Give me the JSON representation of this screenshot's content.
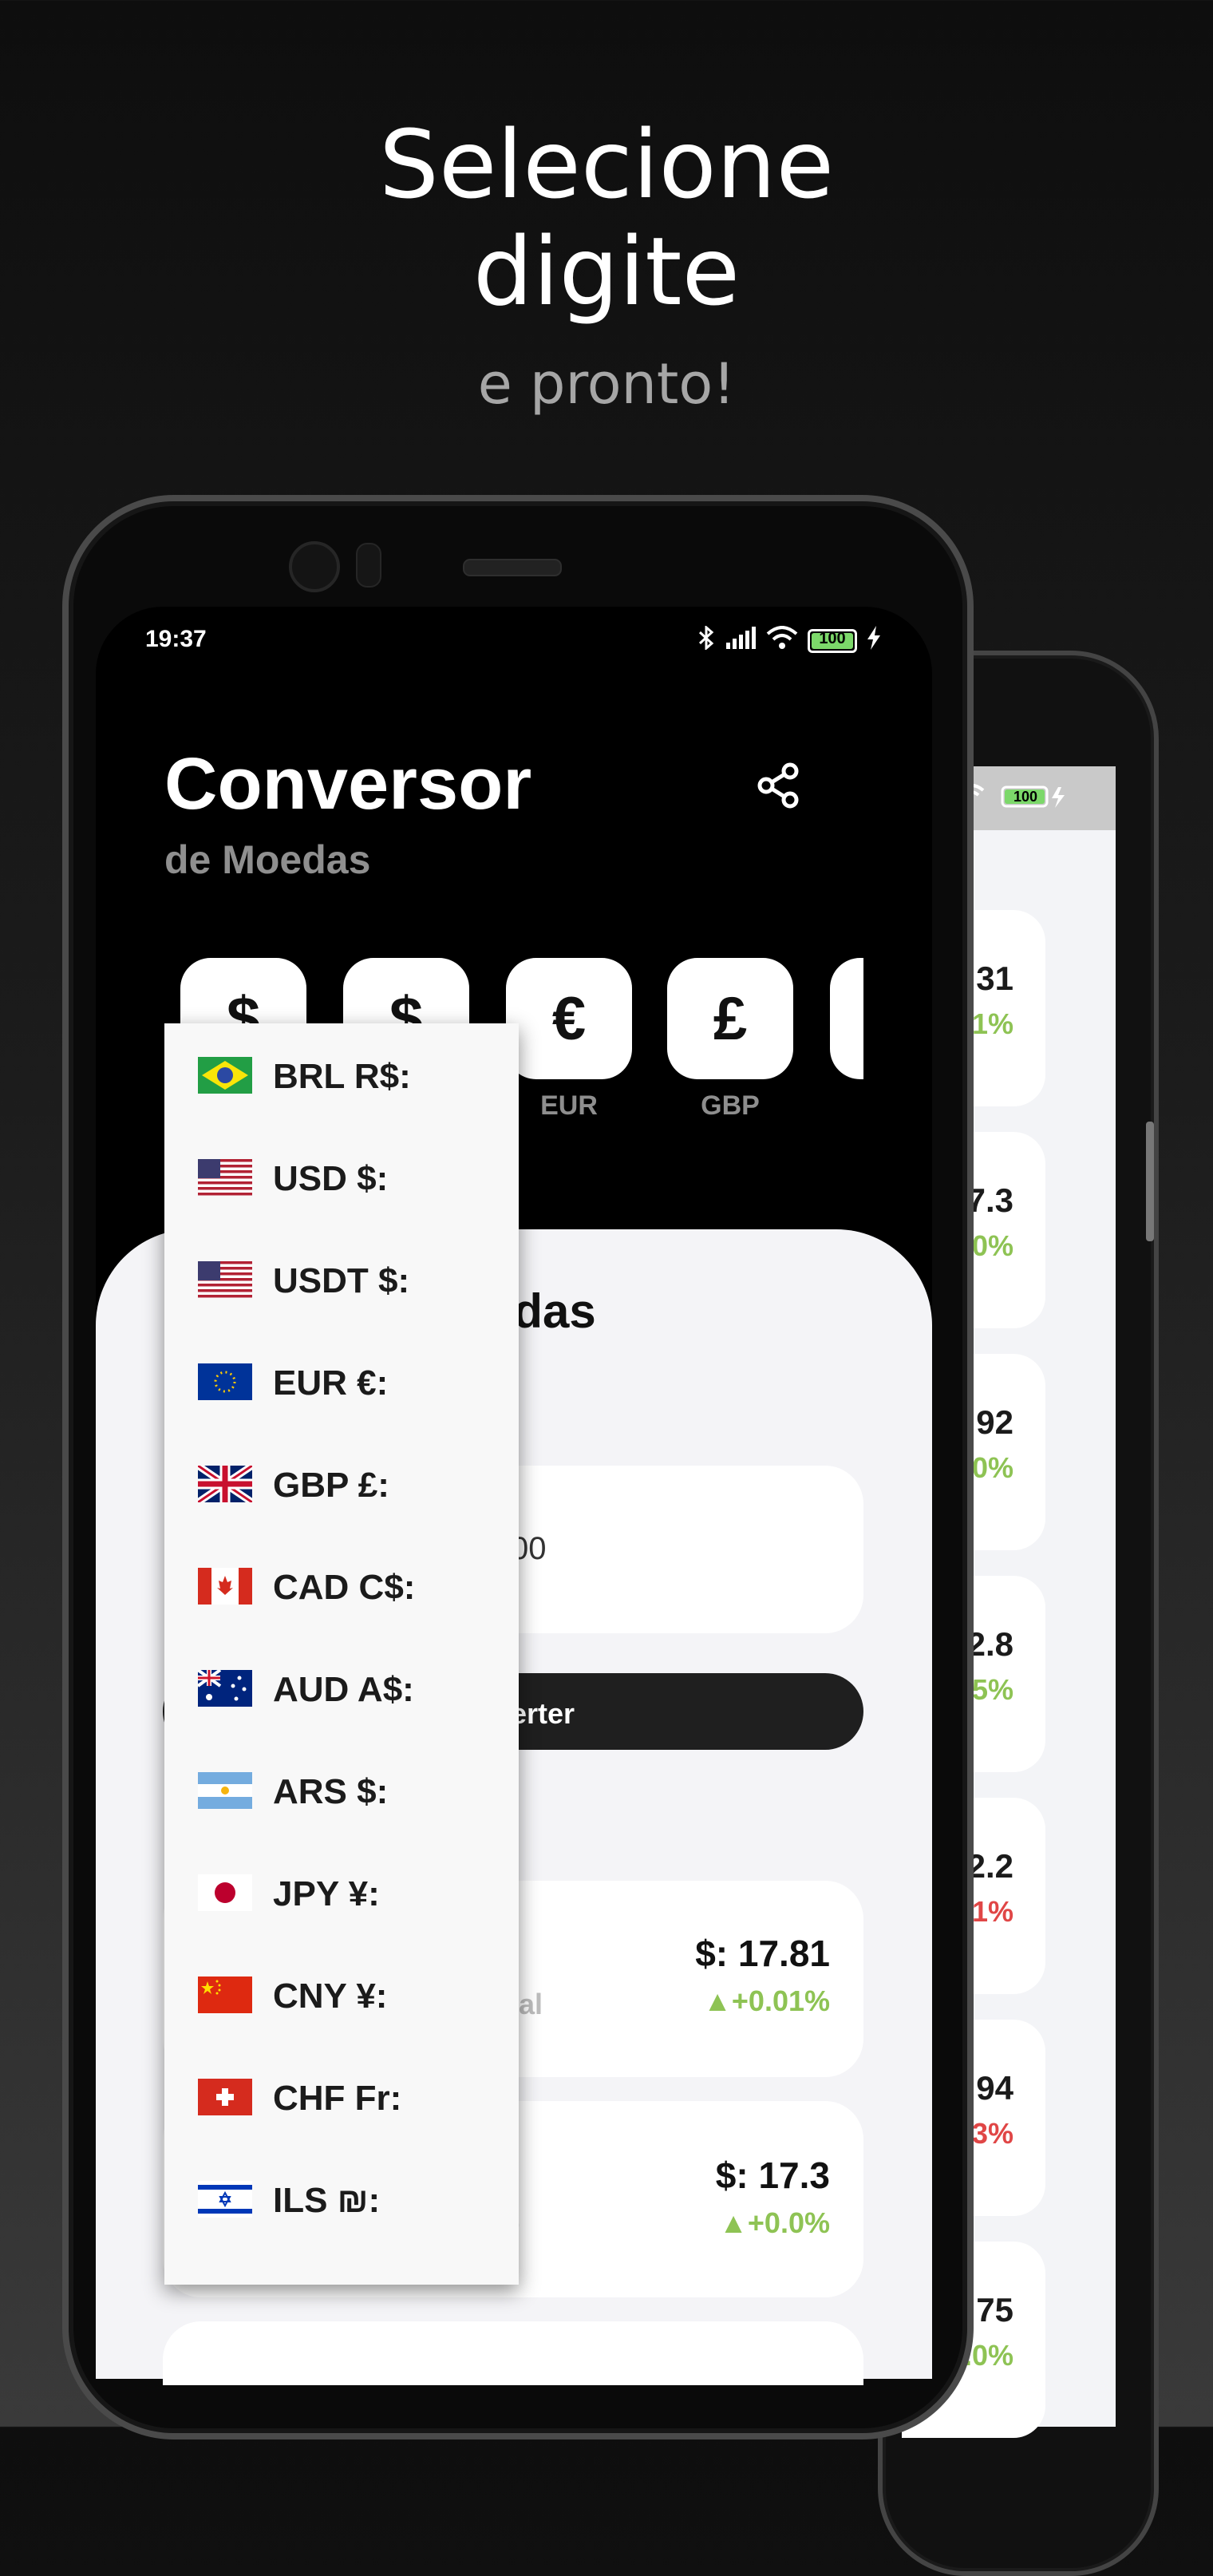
{
  "promo": {
    "line1": "Selecione",
    "line2": "digite",
    "tagline": "e pronto!"
  },
  "status_bar": {
    "time": "19:37",
    "battery": "100"
  },
  "app": {
    "title": "Conversor",
    "subtitle": "de Moedas",
    "share_icon": "share-icon"
  },
  "quick_currencies": [
    {
      "symbol": "$",
      "code": ""
    },
    {
      "symbol": "$",
      "code": ""
    },
    {
      "symbol": "€",
      "code": "EUR"
    },
    {
      "symbol": "£",
      "code": "GBP"
    }
  ],
  "main": {
    "section_title_partial": "edas",
    "amount_partial": "00",
    "convert_label_partial": "erter"
  },
  "results": [
    {
      "value": "$: 17.81",
      "change": "▲+0.01%",
      "hint_partial": "ial"
    },
    {
      "value": "$: 17.3",
      "change": "▲+0.0%",
      "hint_partial": ")"
    }
  ],
  "back_phone": {
    "rows": [
      {
        "value": "31",
        "change": "1%",
        "color": "#8ec354"
      },
      {
        "value": "7.3",
        "change": "0%",
        "color": "#8ec354"
      },
      {
        "value": "92",
        "change": ".0%",
        "color": "#8ec354"
      },
      {
        "value": "2.8",
        "change": "05%",
        "color": "#8ec354"
      },
      {
        "value": "2.2",
        "change": "01%",
        "color": "#e04646"
      },
      {
        "value": "94",
        "change": "03%",
        "color": "#e04646"
      },
      {
        "value": "75",
        "change": "0.0%",
        "color": "#8ec354"
      }
    ]
  },
  "dropdown": {
    "items": [
      {
        "label": "BRL R$:",
        "flag": "brazil-flag"
      },
      {
        "label": "USD $:",
        "flag": "usa-flag"
      },
      {
        "label": "USDT $:",
        "flag": "usa-flag"
      },
      {
        "label": "EUR €:",
        "flag": "eu-flag"
      },
      {
        "label": "GBP £:",
        "flag": "uk-flag"
      },
      {
        "label": "CAD C$:",
        "flag": "canada-flag"
      },
      {
        "label": "AUD A$:",
        "flag": "australia-flag"
      },
      {
        "label": "ARS $:",
        "flag": "argentina-flag"
      },
      {
        "label": "JPY ¥:",
        "flag": "japan-flag"
      },
      {
        "label": "CNY ¥:",
        "flag": "china-flag"
      },
      {
        "label": "CHF Fr:",
        "flag": "switzerland-flag"
      },
      {
        "label": "ILS ₪:",
        "flag": "israel-flag"
      }
    ]
  },
  "colors": {
    "positive": "#8ec354",
    "negative": "#e04646",
    "sheet_bg": "#f4f4f7"
  }
}
